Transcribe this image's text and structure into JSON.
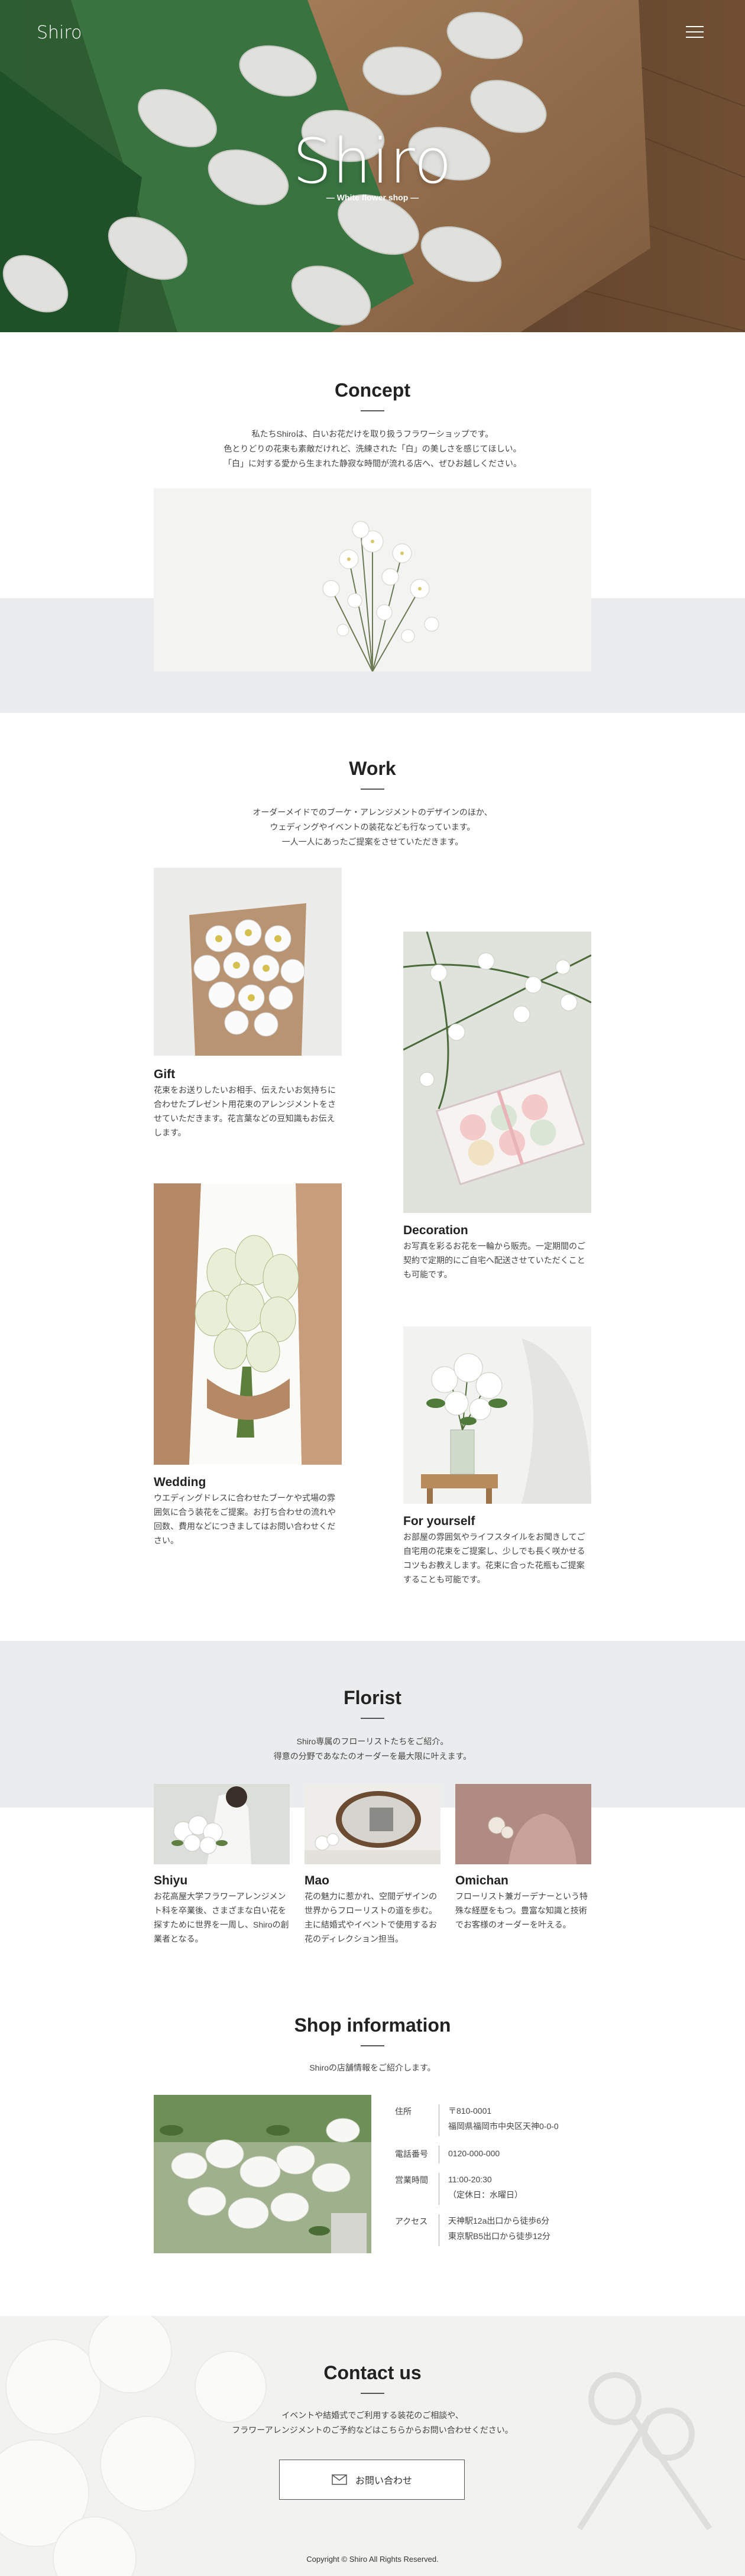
{
  "header": {
    "logo": "Shiro",
    "menu_icon": "hamburger-menu-icon"
  },
  "hero": {
    "title": "Shiro",
    "subtitle": "— White flower shop —"
  },
  "concept": {
    "title": "Concept",
    "text": [
      "私たちShiroは、白いお花だけを取り扱うフラワーショップです。",
      "色とりどりの花束も素敵だけれど、洗練された「白」の美しさを感じてほしい。",
      "「白」に対する愛から生まれた静寂な時間が流れる店へ、ぜひお越しください。"
    ]
  },
  "work": {
    "title": "Work",
    "text": [
      "オーダーメイドでのブーケ・アレンジメントのデザインのほか、",
      "ウェディングやイベントの装花なども行なっています。",
      "一人一人にあったご提案をさせていただきます。"
    ],
    "items": [
      {
        "name": "Gift",
        "desc": [
          "花束をお送りしたいお相手、伝えたいお気持ちに",
          "合わせたプレゼント用花束のアレンジメントをさ",
          "せていただきます。花言葉などの豆知識もお伝え",
          "します。"
        ]
      },
      {
        "name": "Decoration",
        "desc": [
          "お写真を彩るお花を一輪から販売。一定期間のご",
          "契約で定期的にご自宅へ配送させていただくこと",
          "も可能です。"
        ]
      },
      {
        "name": "Wedding",
        "desc": [
          "ウエディングドレスに合わせたブーケや式場の雰",
          "囲気に合う装花をご提案。お打ち合わせの流れや",
          "回数、費用などにつきましてはお問い合わせくだ",
          "さい。"
        ]
      },
      {
        "name": "For yourself",
        "desc": [
          "お部屋の雰囲気やライフスタイルをお聞きしてご",
          "自宅用の花束をご提案し、少しでも長く咲かせる",
          "コツもお教えします。花束に合った花瓶もご提案",
          "することも可能です。"
        ]
      }
    ]
  },
  "florist": {
    "title": "Florist",
    "text": [
      "Shiro専属のフローリストたちをご紹介。",
      "得意の分野であなたのオーダーを最大限に叶えます。"
    ],
    "members": [
      {
        "name": "Shiyu",
        "desc": [
          "お花高屋大学フラワーアレンジメン",
          "ト科を卒業後、さまざまな白い花を",
          "探すために世界を一周し、Shiroの創",
          "業者となる。"
        ]
      },
      {
        "name": "Mao",
        "desc": [
          "花の魅力に惹かれ、空間デザインの",
          "世界からフローリストの道を歩む。",
          "主に結婚式やイベントで使用するお",
          "花のディレクション担当。"
        ]
      },
      {
        "name": "Omichan",
        "desc": [
          "フローリスト兼ガーデナーという特",
          "殊な経歴をもつ。豊富な知識と技術",
          "でお客様のオーダーを叶える。"
        ]
      }
    ]
  },
  "shop": {
    "title": "Shop information",
    "text": "Shiroの店舗情報をご紹介します。",
    "rows": [
      {
        "label": "住所",
        "values": [
          "〒810-0001",
          "福岡県福岡市中央区天神0-0-0"
        ]
      },
      {
        "label": "電話番号",
        "values": [
          "0120-000-000"
        ]
      },
      {
        "label": "営業時間",
        "values": [
          "11:00-20:30",
          "（定休日：水曜日）"
        ]
      },
      {
        "label": "アクセス",
        "values": [
          "天神駅12a出口から徒歩6分",
          "東京駅B5出口から徒歩12分"
        ]
      }
    ]
  },
  "contact": {
    "title": "Contact us",
    "text": [
      "イベントや結婚式でご利用する装花のご相談や、",
      "フラワーアレンジメントのご予約などはこちらからお問い合わせください。"
    ],
    "button_label": "お問い合わせ",
    "button_icon": "envelope-icon"
  },
  "footer": {
    "copyright": "Copyright © Shiro All Rights Reserved."
  },
  "colors": {
    "gray_band": "#ebeced",
    "text": "#333333",
    "hero_wood": "#6b4a33",
    "leaf_green": "#2f6a3a"
  }
}
